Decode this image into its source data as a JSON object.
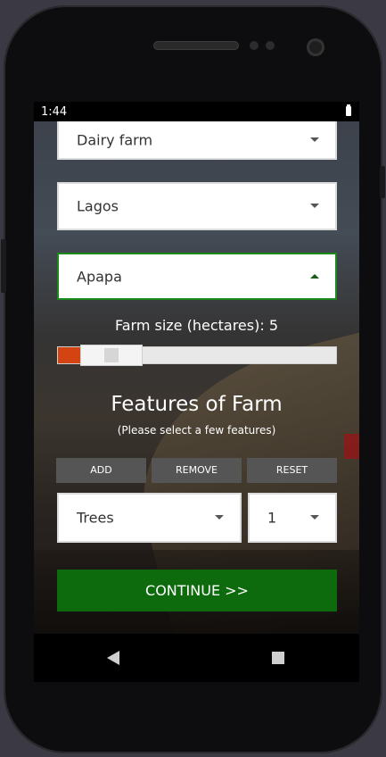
{
  "status_bar": {
    "time": "1:44",
    "icons": [
      "battery-icon"
    ]
  },
  "form": {
    "farm_type": {
      "value": "Dairy farm"
    },
    "state": {
      "value": "Lagos"
    },
    "lga": {
      "value": "Apapa",
      "expanded": true
    },
    "farm_size": {
      "label": "Farm size (hectares): 5",
      "value": 5,
      "fill_fraction": 0.08
    }
  },
  "features": {
    "title": "Features of Farm",
    "subtitle": "(Please select a few features)",
    "buttons": {
      "add": "ADD",
      "remove": "REMOVE",
      "reset": "RESET"
    },
    "feature_select": {
      "value": "Trees"
    },
    "quantity_select": {
      "value": "1"
    }
  },
  "continue_label": "CONTINUE >>",
  "colors": {
    "accent_green": "#0d6b0d",
    "focus_border": "#1a8a1a",
    "slider_fill": "#d34412",
    "action_button_bg": "#555555"
  },
  "navbar": {
    "icons": [
      "back-icon",
      "recents-icon"
    ]
  }
}
